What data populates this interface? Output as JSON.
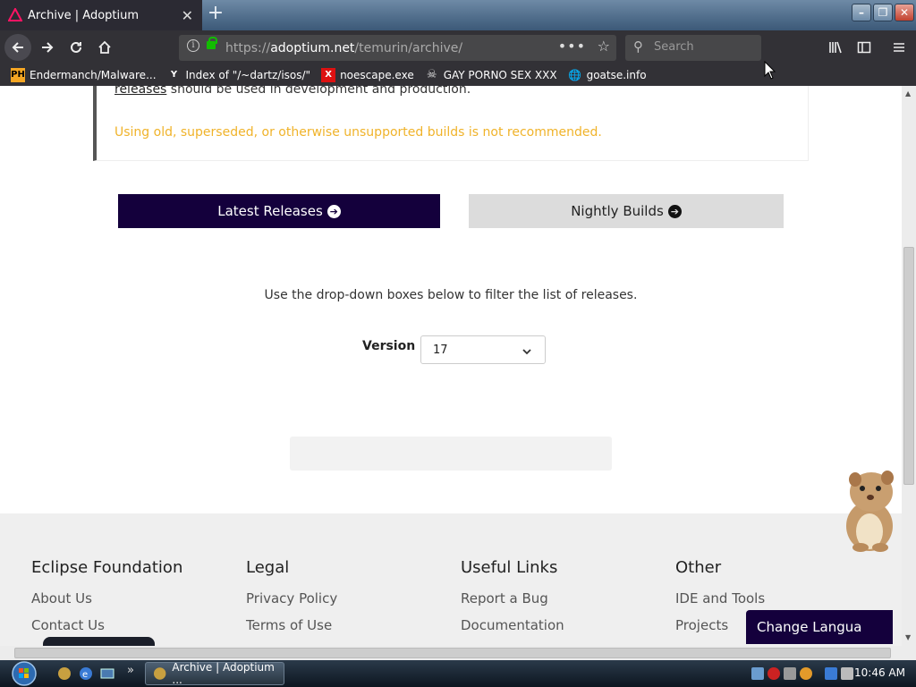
{
  "browser": {
    "tab_title": "Archive | Adoptium",
    "tab_close": "✕",
    "newtab": "+",
    "url_prefix": "https://",
    "url_domain": "adoptium.net",
    "url_path": "/temurin/archive/",
    "search_placeholder": "Search",
    "bookmarks": [
      {
        "label": "Endermanch/Malware...",
        "icon": "PH"
      },
      {
        "label": "Index of \"/~dartz/isos/\"",
        "icon": "Y"
      },
      {
        "label": "noescape.exe",
        "icon": "X"
      },
      {
        "label": "GAY PORNO SEX XXX",
        "icon": "☠"
      },
      {
        "label": "goatse.info",
        "icon": "🌐"
      }
    ]
  },
  "notice": {
    "link_text": "releases",
    "line1_rest": " should be used in development and production.",
    "warning": "Using old, superseded, or otherwise unsupported builds is not recommended.",
    "warning_color": "#f0b32a"
  },
  "buttons": {
    "latest": "Latest Releases",
    "nightly": "Nightly Builds",
    "arrow": "➔"
  },
  "filter": {
    "text": "Use the drop-down boxes below to filter the list of releases.",
    "version_label": "Version",
    "version_value": "17"
  },
  "footer": {
    "columns": [
      {
        "title": "Eclipse Foundation",
        "links": [
          "About Us",
          "Contact Us"
        ]
      },
      {
        "title": "Legal",
        "links": [
          "Privacy Policy",
          "Terms of Use"
        ]
      },
      {
        "title": "Useful Links",
        "links": [
          "Report a Bug",
          "Documentation"
        ]
      },
      {
        "title": "Other",
        "links": [
          "IDE and Tools",
          "Projects"
        ]
      }
    ],
    "change_language": "Change Langua"
  },
  "taskbar": {
    "task_label": "Archive | Adoptium ...",
    "clock": "10:46 AM",
    "overflow": "»"
  },
  "colors": {
    "brand_dark": "#14003c",
    "browser_dark": "#323136"
  }
}
